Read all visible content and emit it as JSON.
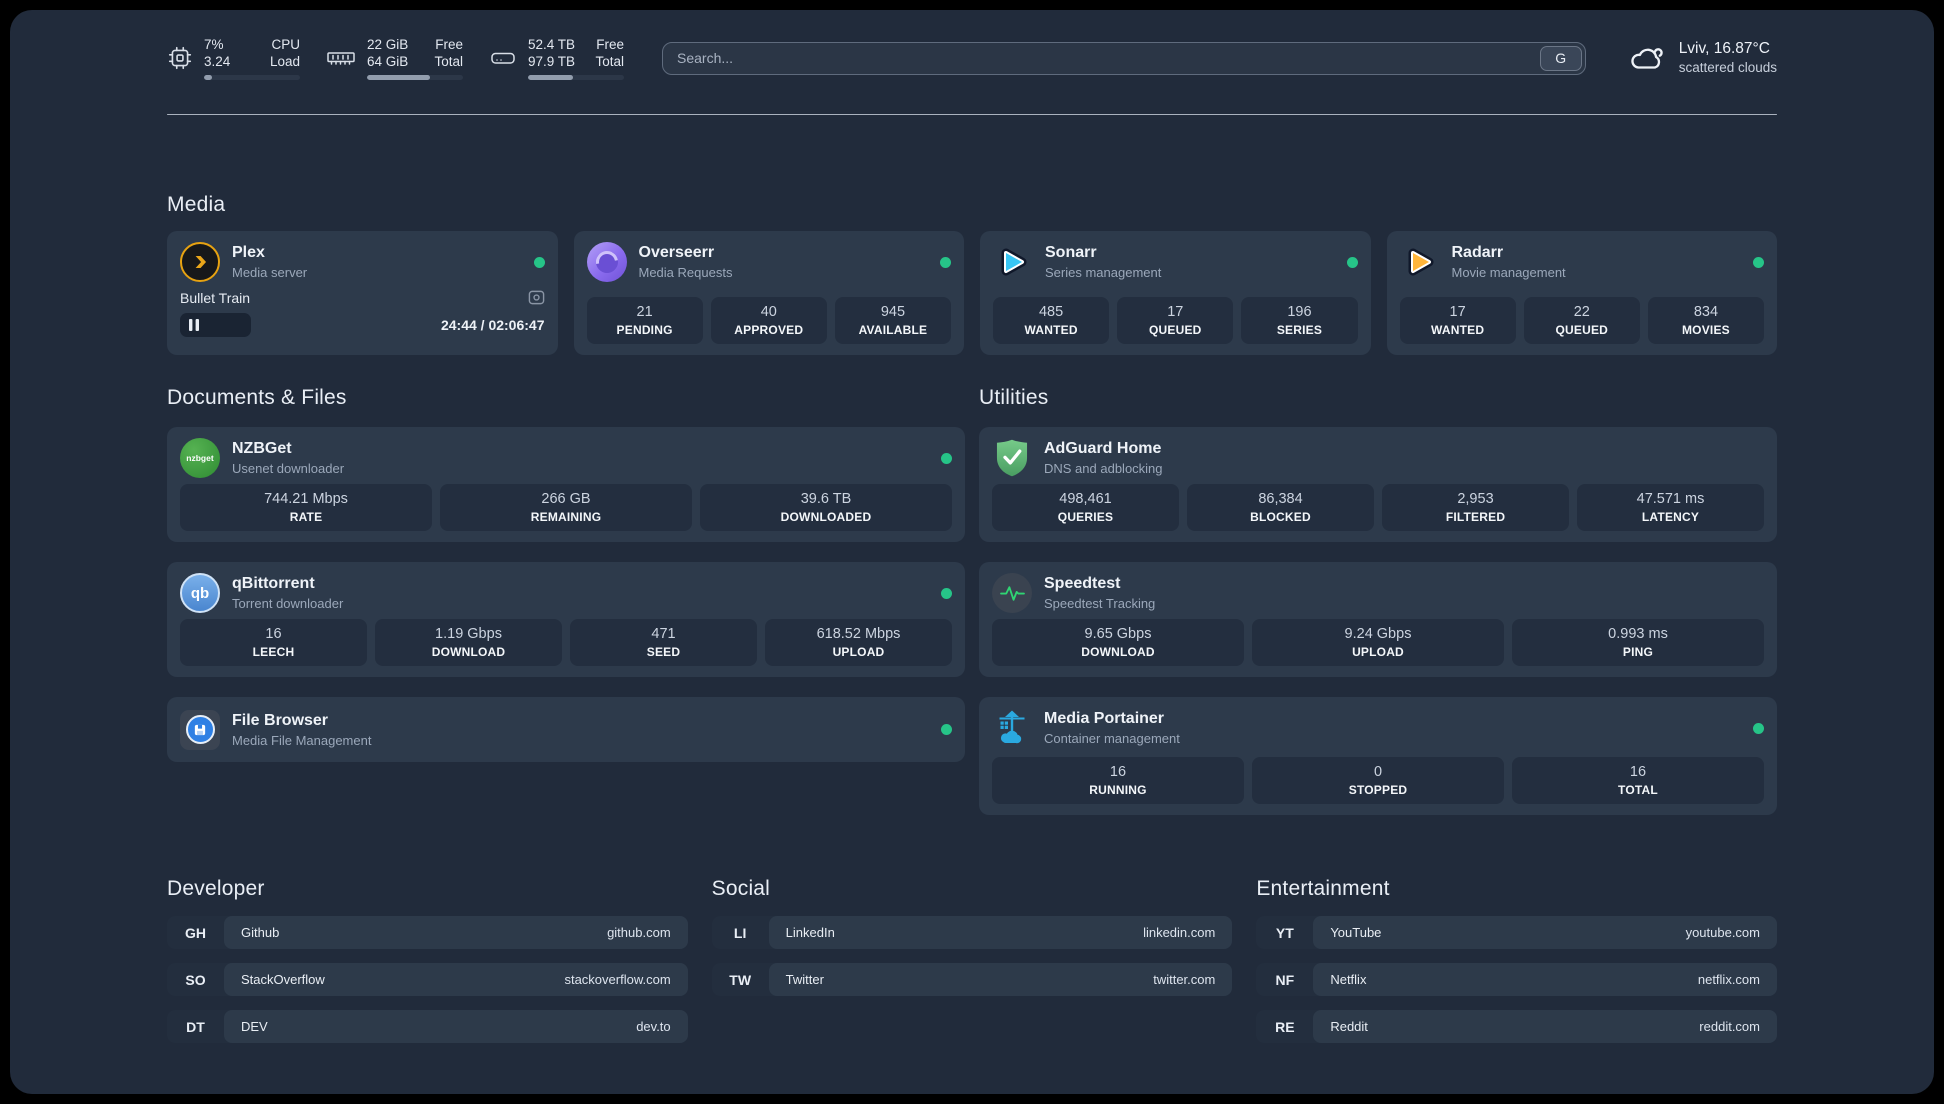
{
  "theme": {
    "status_green": "#26c488",
    "page_bg": "#212b3b",
    "card_bg": "#2d3a4b",
    "stat_bg": "#232e3f"
  },
  "header": {
    "system": [
      {
        "icon": "cpu-icon",
        "values": [
          "7%",
          "3.24"
        ],
        "labels": [
          "CPU",
          "Load"
        ],
        "progress": 8
      },
      {
        "icon": "memory-icon",
        "values": [
          "22 GiB",
          "64 GiB"
        ],
        "labels": [
          "Free",
          "Total"
        ],
        "progress": 66
      },
      {
        "icon": "disk-icon",
        "values": [
          "52.4 TB",
          "97.9 TB"
        ],
        "labels": [
          "Free",
          "Total"
        ],
        "progress": 47
      }
    ],
    "search": {
      "placeholder": "Search...",
      "engine_button": "G"
    },
    "weather": {
      "icon": "cloud-icon",
      "location": "Lviv, 16.87°C",
      "condition": "scattered clouds"
    }
  },
  "sections": {
    "media": {
      "title": "Media",
      "plex": {
        "icon": "plex-icon",
        "title": "Plex",
        "subtitle": "Media server",
        "online": true,
        "now_playing": {
          "title": "Bullet Train",
          "time_display": "24:44 / 02:06:47",
          "state": "paused",
          "progress": 19.5
        }
      },
      "overseerr": {
        "icon": "overseerr-icon",
        "title": "Overseerr",
        "subtitle": "Media Requests",
        "online": true,
        "stats": [
          {
            "value": "21",
            "label": "PENDING"
          },
          {
            "value": "40",
            "label": "APPROVED"
          },
          {
            "value": "945",
            "label": "AVAILABLE"
          }
        ]
      },
      "sonarr": {
        "icon": "sonarr-icon",
        "title": "Sonarr",
        "subtitle": "Series management",
        "online": true,
        "stats": [
          {
            "value": "485",
            "label": "WANTED"
          },
          {
            "value": "17",
            "label": "QUEUED"
          },
          {
            "value": "196",
            "label": "SERIES"
          }
        ]
      },
      "radarr": {
        "icon": "radarr-icon",
        "title": "Radarr",
        "subtitle": "Movie management",
        "online": true,
        "stats": [
          {
            "value": "17",
            "label": "WANTED"
          },
          {
            "value": "22",
            "label": "QUEUED"
          },
          {
            "value": "834",
            "label": "MOVIES"
          }
        ]
      }
    },
    "documents": {
      "title": "Documents & Files",
      "nzbget": {
        "icon": "nzbget-icon",
        "title": "NZBGet",
        "subtitle": "Usenet downloader",
        "online": true,
        "stats": [
          {
            "value": "744.21 Mbps",
            "label": "RATE"
          },
          {
            "value": "266 GB",
            "label": "REMAINING"
          },
          {
            "value": "39.6 TB",
            "label": "DOWNLOADED"
          }
        ]
      },
      "qbittorrent": {
        "icon": "qbittorrent-icon",
        "title": "qBittorrent",
        "subtitle": "Torrent downloader",
        "online": true,
        "stats": [
          {
            "value": "16",
            "label": "LEECH"
          },
          {
            "value": "1.19 Gbps",
            "label": "DOWNLOAD"
          },
          {
            "value": "471",
            "label": "SEED"
          },
          {
            "value": "618.52 Mbps",
            "label": "UPLOAD"
          }
        ]
      },
      "filebrowser": {
        "icon": "filebrowser-icon",
        "title": "File Browser",
        "subtitle": "Media File Management",
        "online": true
      }
    },
    "utilities": {
      "title": "Utilities",
      "adguard": {
        "icon": "adguard-icon",
        "title": "AdGuard Home",
        "subtitle": "DNS and adblocking",
        "stats": [
          {
            "value": "498,461",
            "label": "QUERIES"
          },
          {
            "value": "86,384",
            "label": "BLOCKED"
          },
          {
            "value": "2,953",
            "label": "FILTERED"
          },
          {
            "value": "47.571 ms",
            "label": "LATENCY"
          }
        ]
      },
      "speedtest": {
        "icon": "speedtest-icon",
        "title": "Speedtest",
        "subtitle": "Speedtest Tracking",
        "stats": [
          {
            "value": "9.65 Gbps",
            "label": "DOWNLOAD"
          },
          {
            "value": "9.24 Gbps",
            "label": "UPLOAD"
          },
          {
            "value": "0.993 ms",
            "label": "PING"
          }
        ]
      },
      "portainer": {
        "icon": "portainer-icon",
        "title": "Media Portainer",
        "subtitle": "Container management",
        "online": true,
        "stats": [
          {
            "value": "16",
            "label": "RUNNING"
          },
          {
            "value": "0",
            "label": "STOPPED"
          },
          {
            "value": "16",
            "label": "TOTAL"
          }
        ]
      }
    },
    "developer": {
      "title": "Developer",
      "links": [
        {
          "abbr": "GH",
          "name": "Github",
          "url": "github.com"
        },
        {
          "abbr": "SO",
          "name": "StackOverflow",
          "url": "stackoverflow.com"
        },
        {
          "abbr": "DT",
          "name": "DEV",
          "url": "dev.to"
        }
      ]
    },
    "social": {
      "title": "Social",
      "links": [
        {
          "abbr": "LI",
          "name": "LinkedIn",
          "url": "linkedin.com"
        },
        {
          "abbr": "TW",
          "name": "Twitter",
          "url": "twitter.com"
        }
      ]
    },
    "entertainment": {
      "title": "Entertainment",
      "links": [
        {
          "abbr": "YT",
          "name": "YouTube",
          "url": "youtube.com"
        },
        {
          "abbr": "NF",
          "name": "Netflix",
          "url": "netflix.com"
        },
        {
          "abbr": "RE",
          "name": "Reddit",
          "url": "reddit.com"
        }
      ]
    }
  }
}
